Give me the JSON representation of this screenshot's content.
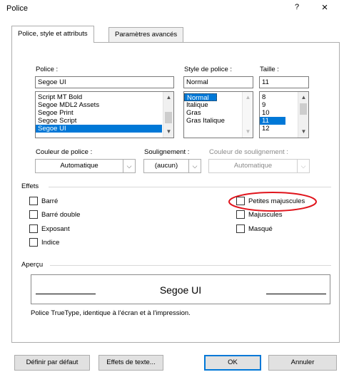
{
  "window": {
    "title": "Police",
    "help_label": "?",
    "close_label": "×"
  },
  "tabs": [
    {
      "label": "Police, style et attributs"
    },
    {
      "label": "Paramètres avancés"
    }
  ],
  "font_name": {
    "label": "Police :",
    "value": "Segoe UI",
    "items": [
      "Script MT Bold",
      "Segoe MDL2 Assets",
      "Segoe Print",
      "Segoe Script",
      "Segoe UI"
    ],
    "selected": "Segoe UI"
  },
  "font_style": {
    "label": "Style de police :",
    "value": "Normal",
    "items": [
      "Normal",
      "Italique",
      "Gras",
      "Gras Italique"
    ],
    "selected": "Normal"
  },
  "font_size": {
    "label": "Taille :",
    "value": "11",
    "items": [
      "8",
      "9",
      "10",
      "11",
      "12"
    ],
    "selected": "11"
  },
  "font_color": {
    "label": "Couleur de police :",
    "value": "Automatique"
  },
  "underline_style": {
    "label": "Soulignement :",
    "value": "(aucun)"
  },
  "underline_color": {
    "label": "Couleur de soulignement :",
    "value": "Automatique"
  },
  "effects": {
    "label": "Effets",
    "left": [
      "Barré",
      "Barré double",
      "Exposant",
      "Indice"
    ],
    "right": [
      "Petites majuscules",
      "Majuscules",
      "Masqué"
    ]
  },
  "preview": {
    "label": "Aperçu",
    "sample": "Segoe UI",
    "note": "Police TrueType, identique à l'écran et à l'impression."
  },
  "buttons": {
    "set_default": "Définir par défaut",
    "text_effects": "Effets de texte...",
    "ok": "OK",
    "cancel": "Annuler"
  },
  "colors": {
    "accent": "#0078d7",
    "highlight_circle": "#e0141c"
  },
  "icons": {
    "dropdown": "chevron-down-icon",
    "scroll_up": "chevron-up-icon"
  }
}
